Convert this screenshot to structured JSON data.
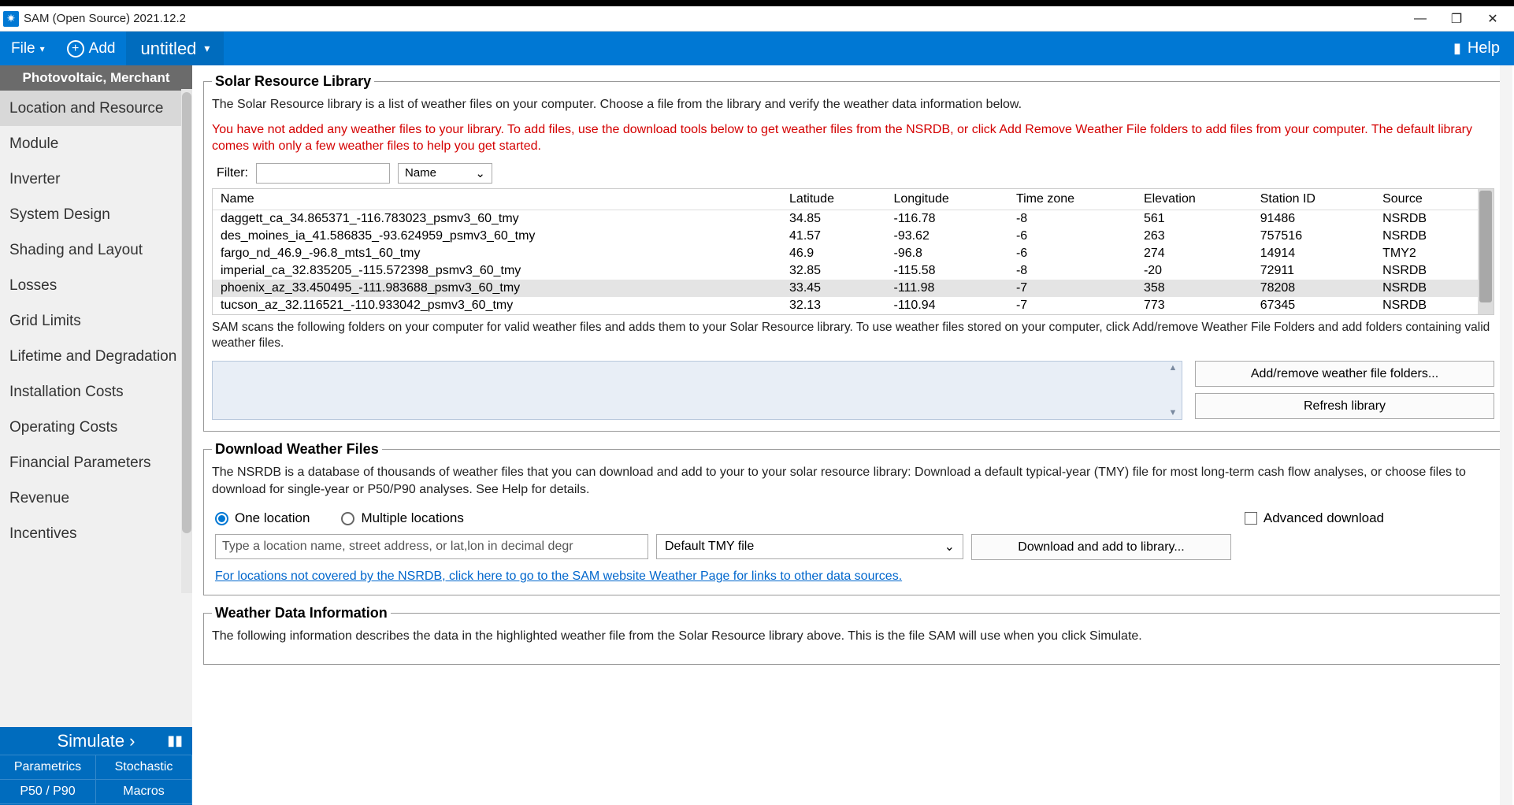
{
  "window": {
    "title": "SAM (Open Source) 2021.12.2"
  },
  "menubar": {
    "file": "File",
    "add": "Add",
    "tab": "untitled",
    "help": "Help"
  },
  "sidebar": {
    "header": "Photovoltaic, Merchant",
    "items": [
      "Location and Resource",
      "Module",
      "Inverter",
      "System Design",
      "Shading and Layout",
      "Losses",
      "Grid Limits",
      "Lifetime and Degradation",
      "Installation Costs",
      "Operating Costs",
      "Financial Parameters",
      "Revenue",
      "Incentives"
    ],
    "active_index": 0
  },
  "sim": {
    "simulate": "Simulate ›",
    "parametrics": "Parametrics",
    "stochastic": "Stochastic",
    "p50p90": "P50 / P90",
    "macros": "Macros"
  },
  "library": {
    "legend": "Solar Resource Library",
    "desc": "The Solar Resource library is a list of weather files on your computer. Choose a file from the library and verify the weather data information below.",
    "warning": "You have not added any weather files to your library. To add files, use the download tools below to get weather files from the NSRDB, or click Add Remove Weather File folders to add files from your computer. The default library comes with only a few weather files to help you get started.",
    "filter_label": "Filter:",
    "filter_value": "",
    "filter_field": "Name",
    "columns": [
      "Name",
      "Latitude",
      "Longitude",
      "Time zone",
      "Elevation",
      "Station ID",
      "Source"
    ],
    "rows": [
      {
        "name": "daggett_ca_34.865371_-116.783023_psmv3_60_tmy",
        "lat": "34.85",
        "lon": "-116.78",
        "tz": "-8",
        "elev": "561",
        "sid": "91486",
        "src": "NSRDB"
      },
      {
        "name": "des_moines_ia_41.586835_-93.624959_psmv3_60_tmy",
        "lat": "41.57",
        "lon": "-93.62",
        "tz": "-6",
        "elev": "263",
        "sid": "757516",
        "src": "NSRDB"
      },
      {
        "name": "fargo_nd_46.9_-96.8_mts1_60_tmy",
        "lat": "46.9",
        "lon": "-96.8",
        "tz": "-6",
        "elev": "274",
        "sid": "14914",
        "src": "TMY2"
      },
      {
        "name": "imperial_ca_32.835205_-115.572398_psmv3_60_tmy",
        "lat": "32.85",
        "lon": "-115.58",
        "tz": "-8",
        "elev": "-20",
        "sid": "72911",
        "src": "NSRDB"
      },
      {
        "name": "phoenix_az_33.450495_-111.983688_psmv3_60_tmy",
        "lat": "33.45",
        "lon": "-111.98",
        "tz": "-7",
        "elev": "358",
        "sid": "78208",
        "src": "NSRDB"
      },
      {
        "name": "tucson_az_32.116521_-110.933042_psmv3_60_tmy",
        "lat": "32.13",
        "lon": "-110.94",
        "tz": "-7",
        "elev": "773",
        "sid": "67345",
        "src": "NSRDB"
      }
    ],
    "selected_index": 4,
    "note": "SAM scans the following folders on your computer for valid weather files and adds them to your Solar Resource library. To use weather files stored on your computer, click Add/remove Weather File Folders and add folders containing valid weather files.",
    "btn_addremove": "Add/remove weather file folders...",
    "btn_refresh": "Refresh library"
  },
  "download": {
    "legend": "Download Weather Files",
    "desc": "The NSRDB is a database of thousands of weather files that you can download and add to your to your solar resource library: Download a default typical-year (TMY) file for most long-term cash flow analyses, or choose files to download for single-year or P50/P90 analyses. See Help for details.",
    "radio_one": "One location",
    "radio_multi": "Multiple locations",
    "chk_advanced": "Advanced download",
    "loc_placeholder": "Type a location name, street address, or lat,lon in decimal degr",
    "tmy_default": "Default TMY file",
    "btn_download": "Download and add to library...",
    "link": "For locations not covered by the NSRDB, click here to go to the SAM website Weather Page for links to other data sources."
  },
  "weatherinfo": {
    "legend": "Weather Data Information",
    "desc": "The following information describes the data in the highlighted weather file from the Solar Resource library above. This is the file SAM will use when you click Simulate."
  }
}
